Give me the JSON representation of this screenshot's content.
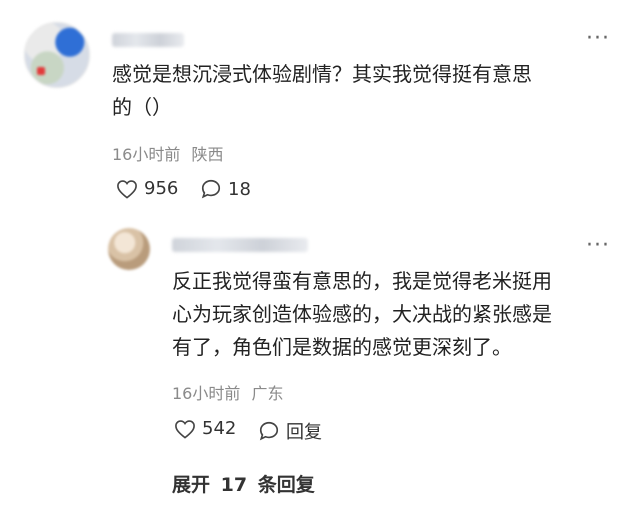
{
  "comment": {
    "text_line1": "感觉是想沉浸式体验剧情？其实我觉得挺有意思",
    "text_line2": "的（）",
    "time": "16小时前",
    "location": "陕西",
    "likes": "956",
    "replies": "18"
  },
  "reply": {
    "text_line1": "反正我觉得蛮有意思的，我是觉得老米挺用",
    "text_line2": "心为玩家创造体验感的，大决战的紧张感是",
    "text_line3": "有了，角色们是数据的感觉更深刻了。",
    "time": "16小时前",
    "location": "广东",
    "likes": "542",
    "reply_label": "回复"
  },
  "expand": {
    "prefix": "展开",
    "count": "17",
    "suffix": "条回复"
  },
  "icons": {
    "more": "more-dots-icon",
    "like": "heart-icon",
    "comment": "speech-bubble-icon"
  }
}
